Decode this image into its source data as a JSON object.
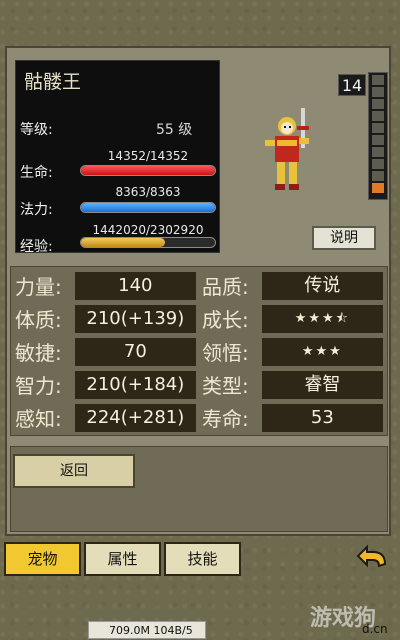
{
  "pet": {
    "name": "骷髅王",
    "level_label": "等级:",
    "level_value": "55 级",
    "hp_label": "生命:",
    "hp_text": "14352/14352",
    "hp_fraction": 1.0,
    "mp_label": "法力:",
    "mp_text": "8363/8363",
    "mp_fraction": 1.0,
    "xp_label": "经验:",
    "xp_text": "1442020/2302920",
    "xp_fraction": 0.626,
    "level_badge": "14",
    "level_meter_fraction": 0.1,
    "describe_button": "说明"
  },
  "stats": {
    "rows": [
      {
        "left_label": "力量:",
        "left_value": "140",
        "right_label": "品质:",
        "right_value": "传说"
      },
      {
        "left_label": "体质:",
        "left_value": "210(+139)",
        "right_label": "成长:",
        "right_value": "★★★⯪"
      },
      {
        "left_label": "敏捷:",
        "left_value": "70",
        "right_label": "领悟:",
        "right_value": "★★★"
      },
      {
        "left_label": "智力:",
        "left_value": "210(+184)",
        "right_label": "类型:",
        "right_value": "睿智"
      },
      {
        "left_label": "感知:",
        "left_value": "224(+281)",
        "right_label": "寿命:",
        "right_value": "53"
      }
    ]
  },
  "back_button": "返回",
  "tabs": [
    {
      "label": "宠物",
      "active": true
    },
    {
      "label": "属性",
      "active": false
    },
    {
      "label": "技能",
      "active": false
    }
  ],
  "status_bar": "709.0M 104B/5",
  "watermark": "游戏狗",
  "watermark_small": "d.cn",
  "colors": {
    "accent_tab": "#f2c830",
    "hp": "#cc1414",
    "mp": "#1a6fd0",
    "xp": "#c48a18"
  }
}
